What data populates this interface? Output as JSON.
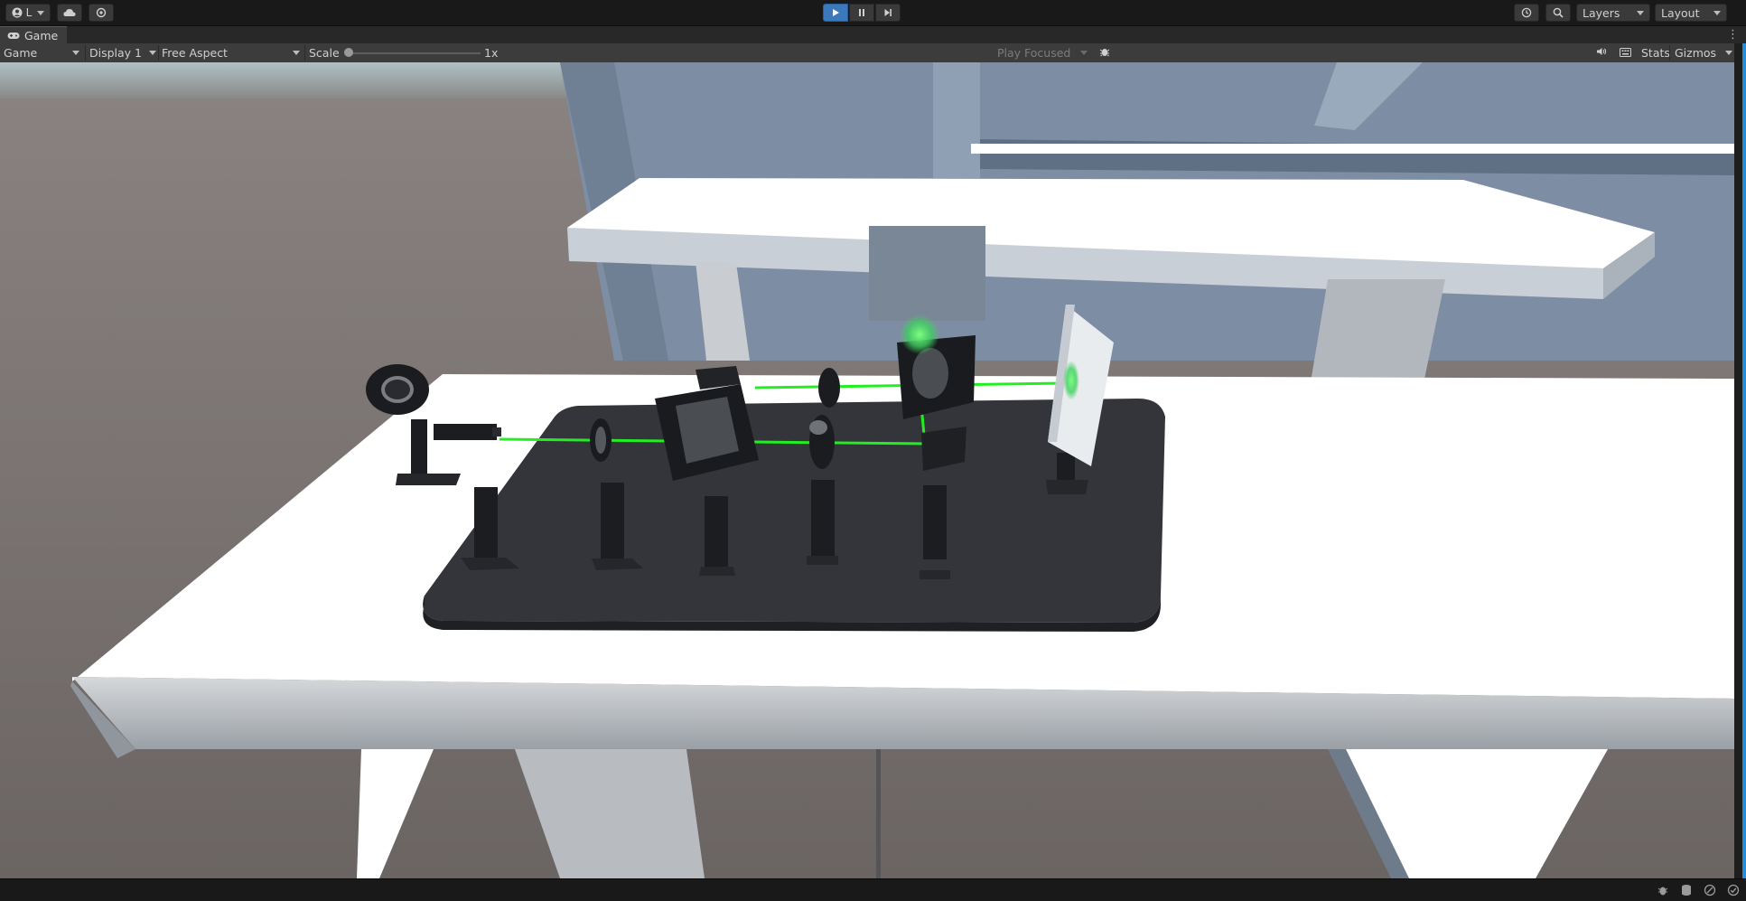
{
  "toolbar": {
    "account_label": "L",
    "layers_label": "Layers",
    "layout_label": "Layout"
  },
  "tab": {
    "label": "Game"
  },
  "game_bar": {
    "view_select": "Game",
    "display_select": "Display 1",
    "aspect_select": "Free Aspect",
    "scale_label": "Scale",
    "scale_value": "1x",
    "scale_slider_fraction": 0.0,
    "play_focused_select": "Play Focused",
    "stats_label": "Stats",
    "gizmos_label": "Gizmos"
  },
  "colors": {
    "play_active": "#3a79bb",
    "laser": "#22ee22",
    "table_top": "#ffffff",
    "breadboard": "#33353a",
    "accent_strip": "#1f8fe0"
  }
}
